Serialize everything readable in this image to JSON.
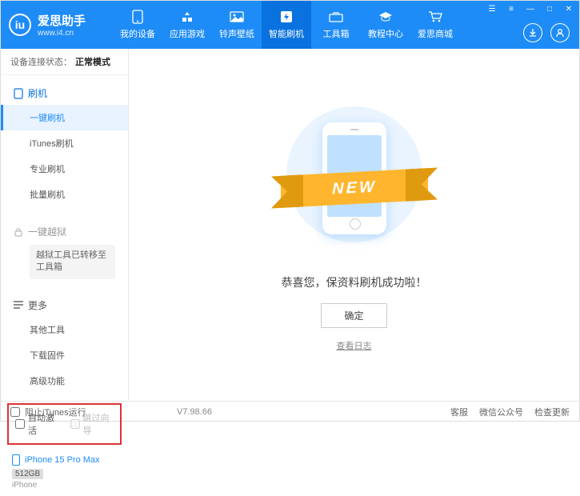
{
  "header": {
    "logo_char": "iu",
    "brand": "爱思助手",
    "url": "www.i4.cn",
    "tabs": [
      "我的设备",
      "应用游戏",
      "铃声壁纸",
      "智能刷机",
      "工具箱",
      "教程中心",
      "爱思商城"
    ]
  },
  "status": {
    "label": "设备连接状态：",
    "value": "正常模式"
  },
  "sidebar": {
    "section1": {
      "title": "刷机",
      "items": [
        "一键刷机",
        "iTunes刷机",
        "专业刷机",
        "批量刷机"
      ]
    },
    "section2": {
      "title": "一键越狱",
      "transfer_note": "越狱工具已转移至工具箱"
    },
    "section3": {
      "title": "更多",
      "items": [
        "其他工具",
        "下载固件",
        "高级功能"
      ]
    }
  },
  "checks": {
    "auto_activate": "自动激活",
    "skip_guide": "跳过向导"
  },
  "device": {
    "name": "iPhone 15 Pro Max",
    "storage": "512GB",
    "type": "iPhone"
  },
  "main": {
    "ribbon": "NEW",
    "success_msg": "恭喜您，保资料刷机成功啦！",
    "ok": "确定",
    "view_log": "查看日志"
  },
  "footer": {
    "block_itunes": "阻止iTunes运行",
    "version": "V7.98.66",
    "links": [
      "客服",
      "微信公众号",
      "检查更新"
    ]
  }
}
